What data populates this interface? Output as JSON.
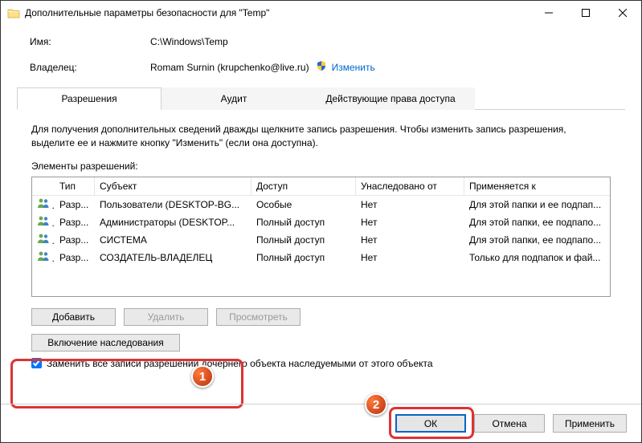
{
  "title": "Дополнительные параметры безопасности  для \"Temp\"",
  "fields": {
    "name_label": "Имя:",
    "name_value": "C:\\Windows\\Temp",
    "owner_label": "Владелец:",
    "owner_value": "Romam Surnin (krupchenko@live.ru)",
    "change_link": "Изменить"
  },
  "tabs": {
    "t1": "Разрешения",
    "t2": "Аудит",
    "t3": "Действующие права доступа"
  },
  "hint": "Для получения дополнительных сведений дважды щелкните запись разрешения. Чтобы изменить запись разрешения, выделите ее и нажмите кнопку \"Изменить\" (если она доступна).",
  "list_label": "Элементы разрешений:",
  "columns": {
    "type": "Тип",
    "subject": "Субъект",
    "access": "Доступ",
    "inherited": "Унаследовано от",
    "applies": "Применяется к"
  },
  "rows": [
    {
      "type": "Разр...",
      "subject": "Пользователи (DESKTOP-BG...",
      "access": "Особые",
      "inherited": "Нет",
      "applies": "Для этой папки и ее подпап..."
    },
    {
      "type": "Разр...",
      "subject": "Администраторы (DESKTOP...",
      "access": "Полный доступ",
      "inherited": "Нет",
      "applies": "Для этой папки, ее подпапо..."
    },
    {
      "type": "Разр...",
      "subject": "СИСТЕМА",
      "access": "Полный доступ",
      "inherited": "Нет",
      "applies": "Для этой папки, ее подпапо..."
    },
    {
      "type": "Разр...",
      "subject": "СОЗДАТЕЛЬ-ВЛАДЕЛЕЦ",
      "access": "Полный доступ",
      "inherited": "Нет",
      "applies": "Только для подпапок и фай..."
    }
  ],
  "buttons": {
    "add": "Добавить",
    "remove": "Удалить",
    "view": "Просмотреть",
    "inherit": "Включение наследования"
  },
  "checkbox_label": "Заменить все записи разрешений дочернего объекта наследуемыми от этого объекта",
  "footer": {
    "ok": "ОК",
    "cancel": "Отмена",
    "apply": "Применить"
  },
  "markers": {
    "m1": "1",
    "m2": "2"
  }
}
